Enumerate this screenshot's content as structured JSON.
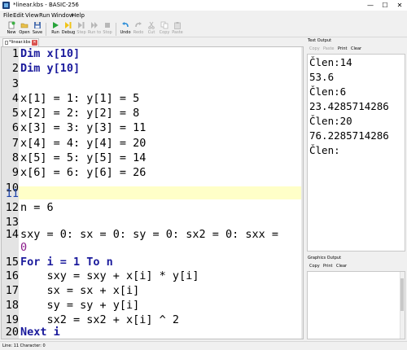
{
  "window": {
    "title": "*linear.kbs - BASIC-256",
    "minimize": "—",
    "maximize": "☐",
    "close": "✕"
  },
  "menu": [
    "File",
    "Edit",
    "View",
    "Run",
    "Window",
    "Help"
  ],
  "toolbar": [
    {
      "label": "New",
      "icon": "new-file-icon",
      "enabled": true
    },
    {
      "label": "Open",
      "icon": "open-folder-icon",
      "enabled": true
    },
    {
      "label": "Save",
      "icon": "save-disk-icon",
      "enabled": true
    },
    {
      "label": "Run",
      "icon": "run-play-icon",
      "enabled": true
    },
    {
      "label": "Debug",
      "icon": "debug-icon",
      "enabled": true
    },
    {
      "label": "Step",
      "icon": "step-icon",
      "enabled": false
    },
    {
      "label": "Run to",
      "icon": "run-to-icon",
      "enabled": false
    },
    {
      "label": "Stop",
      "icon": "stop-icon",
      "enabled": false
    },
    {
      "label": "Undo",
      "icon": "undo-icon",
      "enabled": true
    },
    {
      "label": "Redo",
      "icon": "redo-icon",
      "enabled": false
    },
    {
      "label": "Cut",
      "icon": "cut-icon",
      "enabled": false
    },
    {
      "label": "Copy",
      "icon": "copy-icon",
      "enabled": false
    },
    {
      "label": "Paste",
      "icon": "paste-icon",
      "enabled": false
    }
  ],
  "tab": {
    "label": "*linear.kbs"
  },
  "editor": {
    "current_line": 11,
    "line_numbers": [
      "1",
      "2",
      "3",
      "4",
      "5",
      "6",
      "7",
      "8",
      "9",
      "10",
      "11",
      "12",
      "13",
      "14",
      "",
      "15",
      "16",
      "17",
      "18",
      "19",
      "20"
    ],
    "lines": [
      "Dim x[10]",
      "Dim y[10]",
      "",
      "x[1] = 1: y[1] = 5",
      "x[2] = 2: y[2] = 8",
      "x[3] = 3: y[3] = 11",
      "x[4] = 4: y[4] = 20",
      "x[5] = 5: y[5] = 14",
      "x[6] = 6: y[6] = 26",
      "",
      "",
      "n = 6",
      "",
      "sxy = 0: sx = 0: sy = 0: sx2 = 0: sxx =",
      "0",
      "For i = 1 To n",
      "    sxy = sxy + x[i] * y[i]",
      "    sx = sx + x[i]",
      "    sy = sy + y[i]",
      "    sx2 = sx2 + x[i] ^ 2",
      "Next i"
    ]
  },
  "text_output": {
    "title": "Text Output",
    "buttons": [
      "Copy",
      "Paste",
      "Print",
      "Clear"
    ],
    "lines": [
      "Člen:14",
      "53.6",
      "Člen:6",
      "23.4285714286",
      "Člen:20",
      "76.2285714286",
      "Člen:"
    ]
  },
  "graphics_output": {
    "title": "Graphics Output",
    "buttons": [
      "Copy",
      "Print",
      "Clear"
    ]
  },
  "status": {
    "text": "Line: 11 Character: 0"
  },
  "colors": {
    "keyword": "#1a1a9c",
    "number": "#8a1a8a",
    "current_line_bg": "#ffffc8",
    "gutter_bg": "#e4e4e4"
  }
}
